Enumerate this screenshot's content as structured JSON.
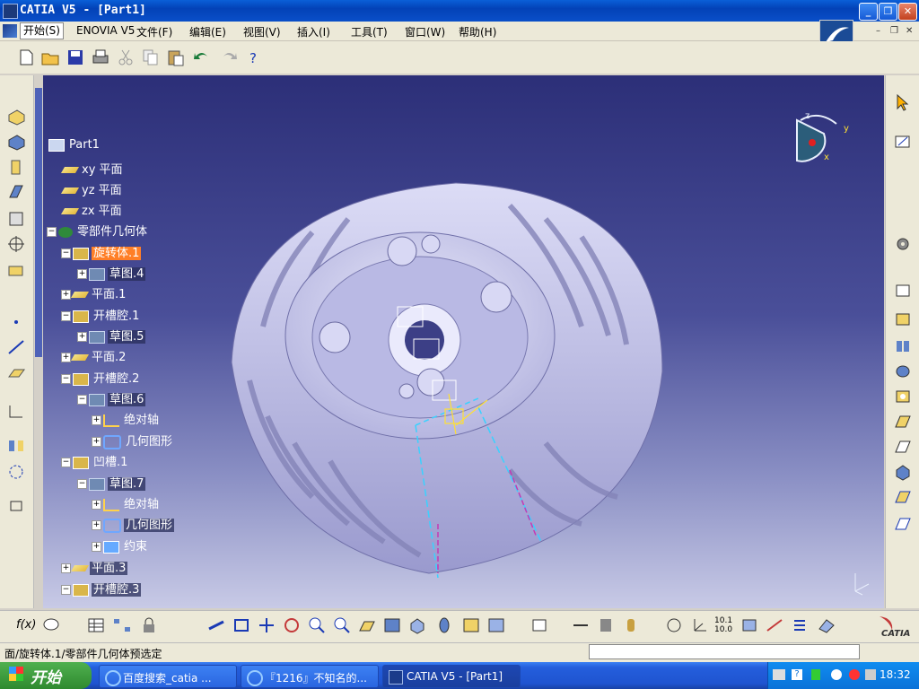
{
  "window": {
    "title": "CATIA V5 - [Part1]"
  },
  "menus": [
    {
      "label": "开始(S)"
    },
    {
      "label": "ENOVIA V5"
    },
    {
      "label": "文件(F)"
    },
    {
      "label": "编辑(E)"
    },
    {
      "label": "视图(V)"
    },
    {
      "label": "插入(I)"
    },
    {
      "label": "工具(T)"
    },
    {
      "label": "窗口(W)"
    },
    {
      "label": "帮助(H)"
    }
  ],
  "tree": [
    {
      "label": "Part1",
      "icon": "part-icon"
    },
    {
      "label": "xy 平面",
      "icon": "plane-icon"
    },
    {
      "label": "yz 平面",
      "icon": "plane-icon"
    },
    {
      "label": "zx 平面",
      "icon": "plane-icon"
    },
    {
      "label": "零部件几何体",
      "icon": "body-icon"
    },
    {
      "label": "旋转体.1",
      "icon": "shaft-icon"
    },
    {
      "label": "草图.4",
      "icon": "sketch-icon"
    },
    {
      "label": "平面.1",
      "icon": "plane-icon"
    },
    {
      "label": "开槽腔.1",
      "icon": "slot-icon"
    },
    {
      "label": "草图.5",
      "icon": "sketch-icon"
    },
    {
      "label": "平面.2",
      "icon": "plane-icon"
    },
    {
      "label": "开槽腔.2",
      "icon": "slot-icon"
    },
    {
      "label": "草图.6",
      "icon": "sketch-icon"
    },
    {
      "label": "绝对轴",
      "icon": "axis-icon"
    },
    {
      "label": "几何图形",
      "icon": "geometry-icon"
    },
    {
      "label": "凹槽.1",
      "icon": "groove-icon"
    },
    {
      "label": "草图.7",
      "icon": "sketch-icon"
    },
    {
      "label": "绝对轴",
      "icon": "axis-icon"
    },
    {
      "label": "几何图形",
      "icon": "geometry-icon"
    },
    {
      "label": "约束",
      "icon": "constraint-icon"
    },
    {
      "label": "平面.3",
      "icon": "plane-icon"
    },
    {
      "label": "开槽腔.3",
      "icon": "slot-icon"
    }
  ],
  "compass": {
    "x": "x",
    "y": "y",
    "z": "z"
  },
  "status": {
    "text": "面/旋转体.1/零部件几何体预选定"
  },
  "taskbar": {
    "start": "开始",
    "tasks": [
      {
        "label": "百度搜索_catia ..."
      },
      {
        "label": "『1216』不知名的..."
      },
      {
        "label": "CATIA V5 - [Part1]"
      }
    ],
    "clock": "18:32"
  },
  "bottom_tool_labels": {
    "fx": "f(x)",
    "ratio": "10.1 10.0"
  },
  "brand": {
    "logo_text": "CATIA"
  },
  "colors": {
    "viewport_top": "#2c2f78",
    "viewport_bottom": "#c8cae6",
    "highlight": "#ff7f27",
    "model": "#c8c8ee"
  }
}
